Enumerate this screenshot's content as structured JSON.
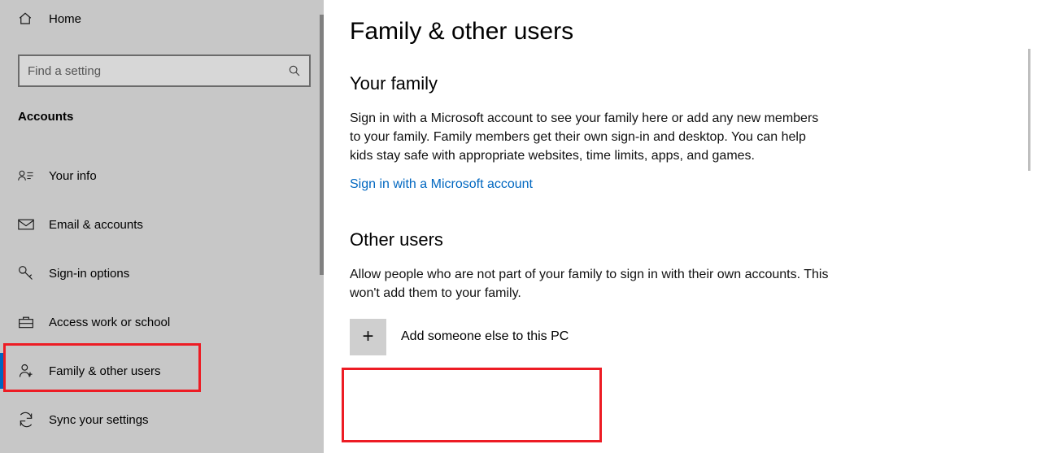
{
  "sidebar": {
    "home_label": "Home",
    "search_placeholder": "Find a setting",
    "section_title": "Accounts",
    "items": [
      {
        "label": "Your info"
      },
      {
        "label": "Email & accounts"
      },
      {
        "label": "Sign-in options"
      },
      {
        "label": "Access work or school"
      },
      {
        "label": "Family & other users"
      },
      {
        "label": "Sync your settings"
      }
    ]
  },
  "main": {
    "title": "Family & other users",
    "family_heading": "Your family",
    "family_body": "Sign in with a Microsoft account to see your family here or add any new members to your family. Family members get their own sign-in and desktop. You can help kids stay safe with appropriate websites, time limits, apps, and games.",
    "signin_link": "Sign in with a Microsoft account",
    "other_heading": "Other users",
    "other_body": "Allow people who are not part of your family to sign in with their own accounts. This won't add them to your family.",
    "add_label": "Add someone else to this PC"
  }
}
